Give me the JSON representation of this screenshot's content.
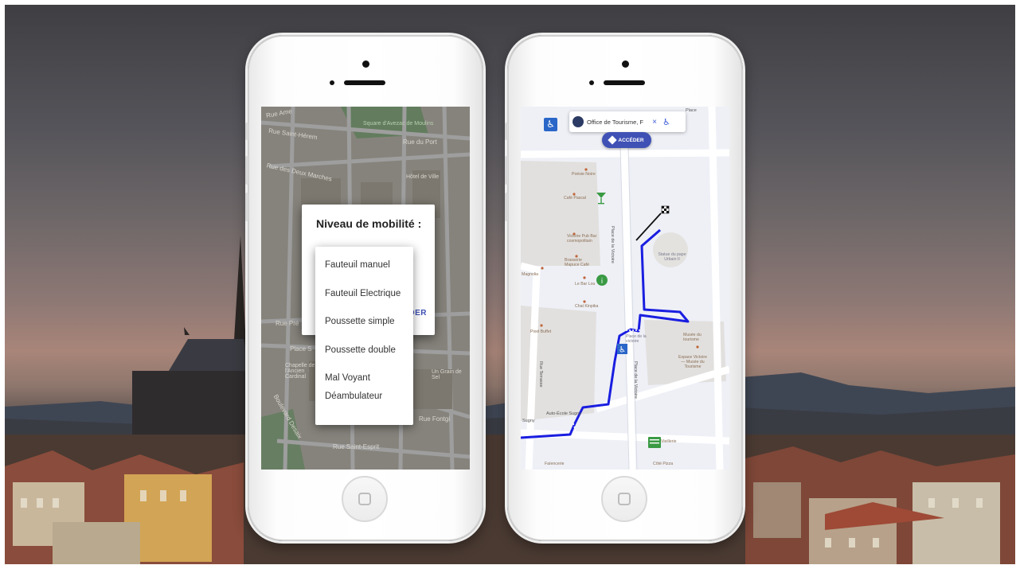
{
  "left_phone": {
    "map_labels": {
      "rue_amelie": "Rue Ame",
      "rue_saint_herem": "Rue Saint-Hérem",
      "square": "Square d'Avezac de Moulins",
      "rue_du_port": "Rue du Port",
      "rue_des_deux_marches": "Rue des Deux Marches",
      "hotel_de_ville": "Hôtel de Ville",
      "rue_pre": "Rue Pré",
      "place_sugny": "Place S",
      "chapelle": "Chapelle de l'Ancien Cardinal",
      "boulevard_desaix": "Boulevard Desaix",
      "rue_saint_esprit": "Rue Saint-Esprit",
      "rue_fontgieve": "Rue Fontgi",
      "un_grain_de_sel": "Un Grain de Sel"
    },
    "dialog": {
      "title": "Niveau de mobilité :",
      "action_fragment": "DER"
    },
    "dropdown_options": [
      "Fauteuil manuel",
      "Fauteuil Electrique",
      "Poussette simple",
      "Poussette double",
      "Mal Voyant",
      "Déambulateur"
    ]
  },
  "right_phone": {
    "wheelchair_icon": "♿",
    "search": {
      "value": "Office de Tourisme, F",
      "clear_icon": "×",
      "mode_icon": "walk-icon"
    },
    "acceder_label": "ACCÉDER",
    "streets": {
      "place_victoire": "Place de la Victoire",
      "rue_terrasse": "Rue Terrasse",
      "place_victoire_2": "Place de la Victoire",
      "rue_sugny": "Sugny",
      "auto_ecole": "Auto-École Sugny",
      "top_right": "Place"
    },
    "poi": {
      "p1": "Poésie Noire",
      "p2": "Café Pascal",
      "p3": "Victoire Pub Bar cosmopolitain",
      "p4": "Brasserie Mapuce Café",
      "p5": "Magnolia",
      "p6": "Le Bar Lou",
      "p7": "Chat Kinpika",
      "p8": "Statue du pape Urbain II",
      "p9": "Place de la victoire",
      "p10": "Musée du tourisme",
      "p11": "Espace Victoire — Musée du Tourisme",
      "p12": "Pixel Buffet",
      "p13": "Vieillerie",
      "p14": "Faïencerie",
      "p15": "Côté Pizza"
    },
    "route_color": "#1a1ee0"
  },
  "colors": {
    "accent": "#3f51b5",
    "wheelchair_blue": "#2a66c8"
  }
}
